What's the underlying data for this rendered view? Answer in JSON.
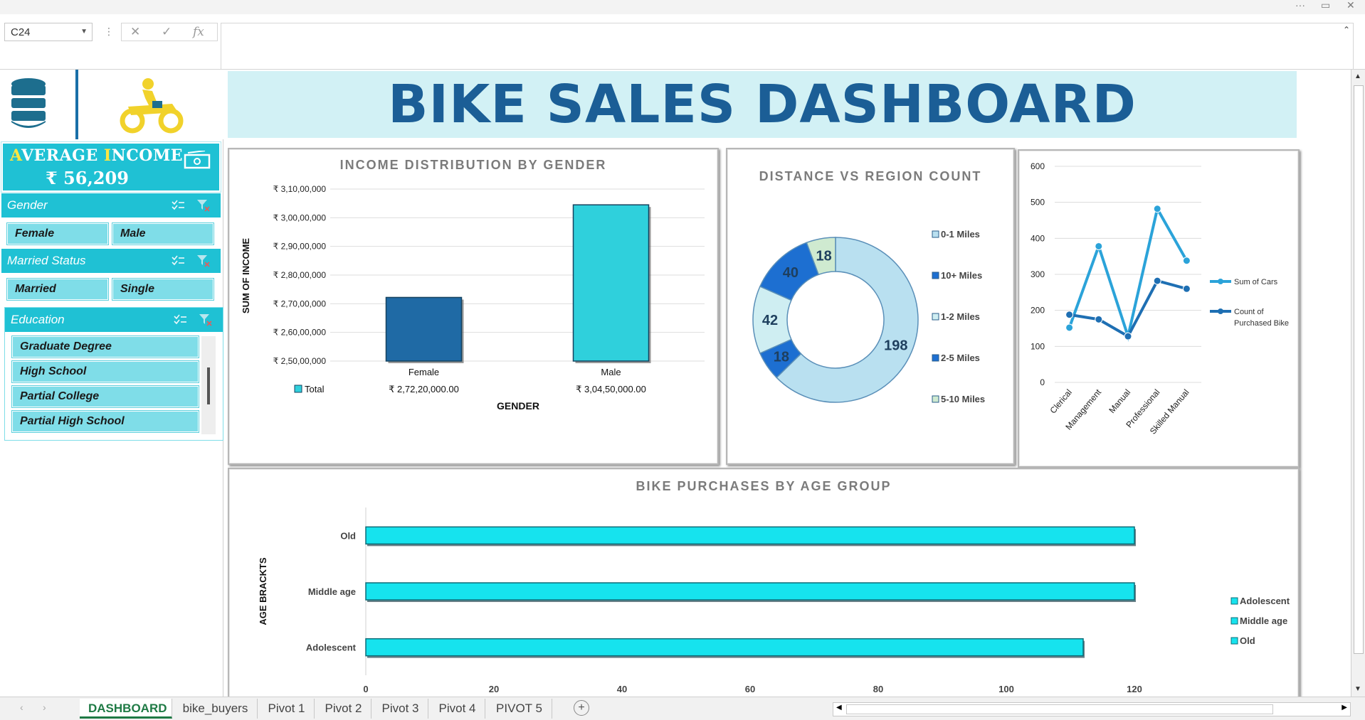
{
  "window": {
    "more_glyph": "···",
    "restore_glyph": "▭",
    "close_glyph": "✕"
  },
  "formula_bar": {
    "name_box": "C24",
    "fx_label": "fx",
    "cancel_glyph": "✕",
    "enter_glyph": "✓",
    "formula": ""
  },
  "dashboard": {
    "title": "BIKE SALES DASHBOARD",
    "average_income": {
      "label": "AVERAGE INCOME",
      "value": "₹ 56,209"
    },
    "slicers": {
      "gender": {
        "title": "Gender",
        "items": [
          "Female",
          "Male"
        ]
      },
      "married_status": {
        "title": "Married Status",
        "items": [
          "Married",
          "Single"
        ]
      },
      "education": {
        "title": "Education",
        "items": [
          "Graduate Degree",
          "High School",
          "Partial College",
          "Partial High School"
        ]
      }
    }
  },
  "chart_data": [
    {
      "type": "bar",
      "title": "INCOME DISTRIBUTION BY GENDER",
      "xlabel": "GENDER",
      "ylabel": "SUM OF INCOME",
      "categories": [
        "Female",
        "Male"
      ],
      "series": [
        {
          "name": "Total",
          "values": [
            272200000,
            304500000
          ],
          "colors": [
            "#1f6aa5",
            "#2fd0dc"
          ]
        }
      ],
      "data_labels": [
        "₹ 2,72,20,000.00",
        "₹ 3,04,50,000.00"
      ],
      "ylim": [
        250000000,
        310000000
      ],
      "y_ticks": [
        250000000,
        260000000,
        270000000,
        280000000,
        290000000,
        300000000,
        310000000
      ],
      "y_tick_labels": [
        "₹ 2,50,00,000",
        "₹ 2,60,00,000",
        "₹ 2,70,00,000",
        "₹ 2,80,00,000",
        "₹ 2,90,00,000",
        "₹ 3,00,00,000",
        "₹ 3,10,00,000"
      ],
      "legend": "data-table",
      "grid": true
    },
    {
      "type": "pie",
      "subtype": "doughnut",
      "title": "DISTANCE VS REGION COUNT",
      "categories": [
        "0-1 Miles",
        "10+ Miles",
        "1-2 Miles",
        "2-5 Miles",
        "5-10 Miles"
      ],
      "values": [
        198,
        40,
        42,
        18,
        18
      ],
      "slice_order": [
        "0-1 Miles",
        "2-5 Miles",
        "1-2 Miles",
        "10+ Miles",
        "5-10 Miles"
      ],
      "slice_values": [
        198,
        18,
        42,
        40,
        18
      ],
      "colors": {
        "0-1 Miles": "#b9e0f0",
        "10+ Miles": "#1d6fd1",
        "1-2 Miles": "#cfeef2",
        "2-5 Miles": "#1d6fd1",
        "5-10 Miles": "#cfead0"
      },
      "legend": "right"
    },
    {
      "type": "line",
      "title": "",
      "categories": [
        "Clerical",
        "Management",
        "Manual",
        "Professional",
        "Skilled Manual"
      ],
      "series": [
        {
          "name": "Sum of Cars",
          "values": [
            152,
            378,
            128,
            482,
            338
          ],
          "color": "#2ba3d9"
        },
        {
          "name": "Count of Purchased Bike",
          "values": [
            188,
            175,
            128,
            282,
            260
          ],
          "color": "#1e6fb3"
        }
      ],
      "ylim": [
        0,
        600
      ],
      "y_ticks": [
        0,
        100,
        200,
        300,
        400,
        500,
        600
      ],
      "legend": "right",
      "grid": true
    },
    {
      "type": "bar",
      "orientation": "horizontal",
      "title": "BIKE PURCHASES BY AGE GROUP",
      "ylabel": "AGE BRACKTS",
      "categories": [
        "Old",
        "Middle age",
        "Adolescent"
      ],
      "values": [
        120,
        120,
        112
      ],
      "xlim": [
        0,
        120
      ],
      "x_ticks": [
        0,
        20,
        40,
        60,
        80,
        100,
        120
      ],
      "legend_entries": [
        "Adolescent",
        "Middle age",
        "Old"
      ],
      "legend": "right",
      "color": "#16e3ee"
    }
  ],
  "sheet_tabs": [
    "DASHBOARD",
    "bike_buyers",
    "Pivot 1",
    "Pivot 2",
    "Pivot 3",
    "Pivot 4",
    "PIVOT 5"
  ],
  "active_tab": "DASHBOARD"
}
